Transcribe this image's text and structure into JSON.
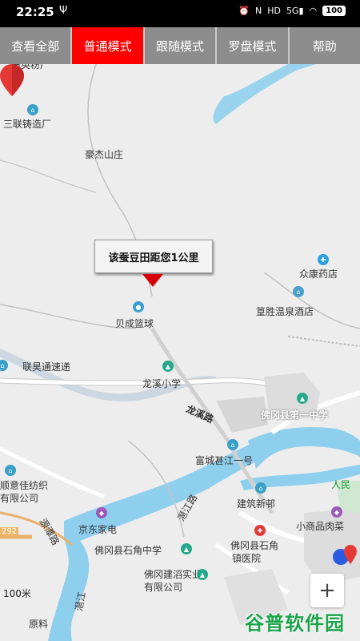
{
  "status": {
    "time": "22:25",
    "usb_icon": "usb-icon",
    "right_items": [
      "⏰",
      "N",
      "HD",
      "5G",
      "📶",
      "WiFi"
    ],
    "battery": "100"
  },
  "tabs": [
    {
      "label": "查看全部",
      "active": false
    },
    {
      "label": "普通模式",
      "active": true
    },
    {
      "label": "跟随模式",
      "active": false
    },
    {
      "label": "罗盘模式",
      "active": false
    },
    {
      "label": "帮助",
      "active": false
    }
  ],
  "map": {
    "callout": "该蚕豆田距您1公里",
    "labels": {
      "l1": "石英粉厂",
      "l2": "三联铸造厂",
      "l3": "豪杰山庄",
      "l4": "众康药店",
      "l5": "篁胜温泉酒店",
      "l6": "贝成篮球",
      "l7": "联昊通速递",
      "l8": "龙溪小学",
      "l9": "龙溪路",
      "l10": "佛冈县第一中学",
      "l11": "富城甚江一号",
      "l12": "顺意佳纺织",
      "l13": "有限公司",
      "l14": "建筑新邨",
      "l15": "人民",
      "l16": "京东家电",
      "l17": "小商品肉菜",
      "l18": "佛冈县石角中学",
      "l19": "佛冈县石角",
      "l20": "镇医院",
      "l21": "佛冈建滔实业",
      "l22": "有限公司",
      "l23": "潖江",
      "l24": "292",
      "l25": "源潭路",
      "l26": "潖江路",
      "l27": "原料"
    },
    "scale": "100米",
    "zoom_in": "+",
    "watermark": "谷普软件园"
  }
}
